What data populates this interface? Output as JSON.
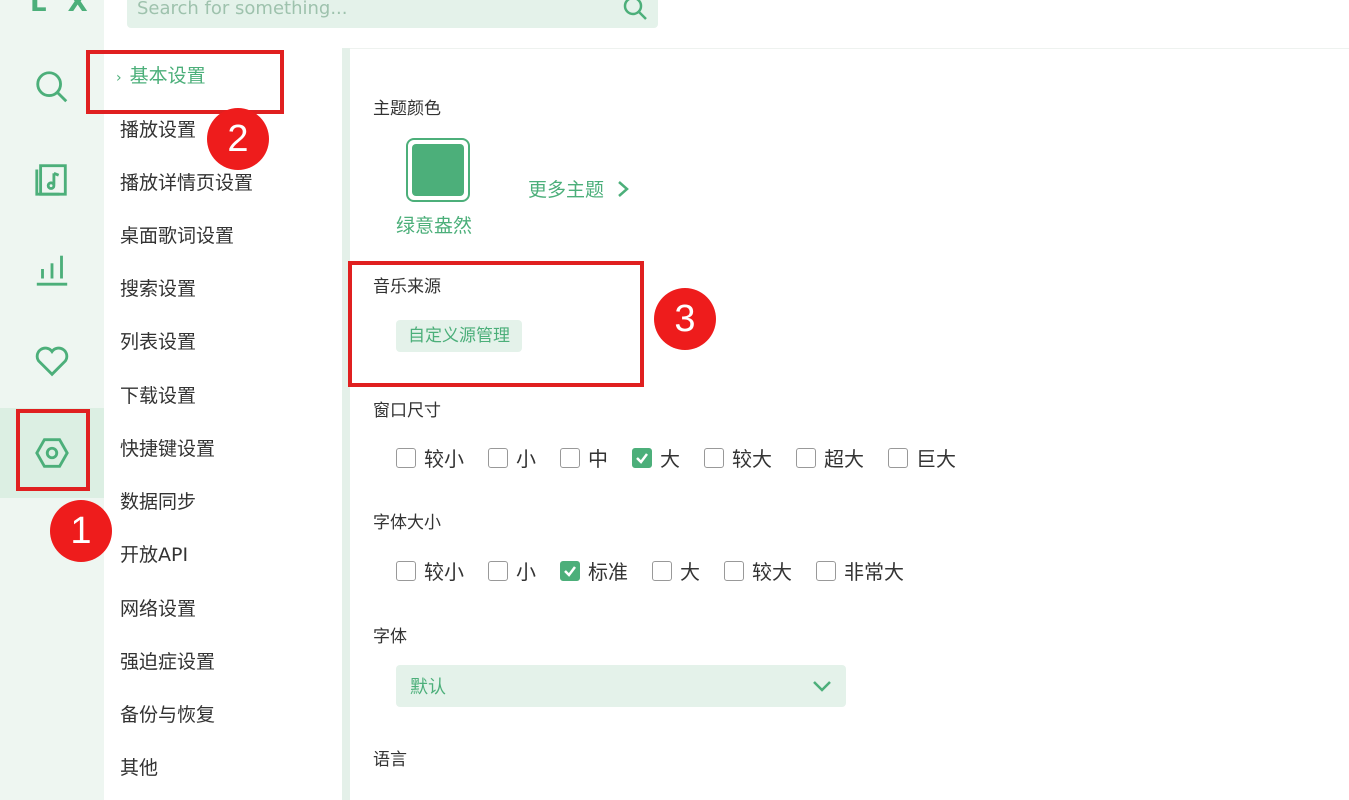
{
  "app": {
    "logo": "L X"
  },
  "search": {
    "placeholder": "Search for something..."
  },
  "nav": {
    "items": [
      "基本设置",
      "播放设置",
      "播放详情页设置",
      "桌面歌词设置",
      "搜索设置",
      "列表设置",
      "下载设置",
      "快捷键设置",
      "数据同步",
      "开放API",
      "网络设置",
      "强迫症设置",
      "备份与恢复",
      "其他"
    ],
    "active_index": 0
  },
  "theme": {
    "title": "主题颜色",
    "current": "绿意盎然",
    "more": "更多主题",
    "color": "#4caf7a"
  },
  "source": {
    "title": "音乐来源",
    "button": "自定义源管理"
  },
  "window_size": {
    "title": "窗口尺寸",
    "options": [
      "较小",
      "小",
      "中",
      "大",
      "较大",
      "超大",
      "巨大"
    ],
    "selected": "大"
  },
  "font_size": {
    "title": "字体大小",
    "options": [
      "较小",
      "小",
      "标准",
      "大",
      "较大",
      "非常大"
    ],
    "selected": "标准"
  },
  "font": {
    "title": "字体",
    "value": "默认"
  },
  "language": {
    "title": "语言"
  },
  "annotations": {
    "badge1": "1",
    "badge2": "2",
    "badge3": "3"
  },
  "colors": {
    "accent": "#4caf7a",
    "annotation": "#e02020"
  }
}
